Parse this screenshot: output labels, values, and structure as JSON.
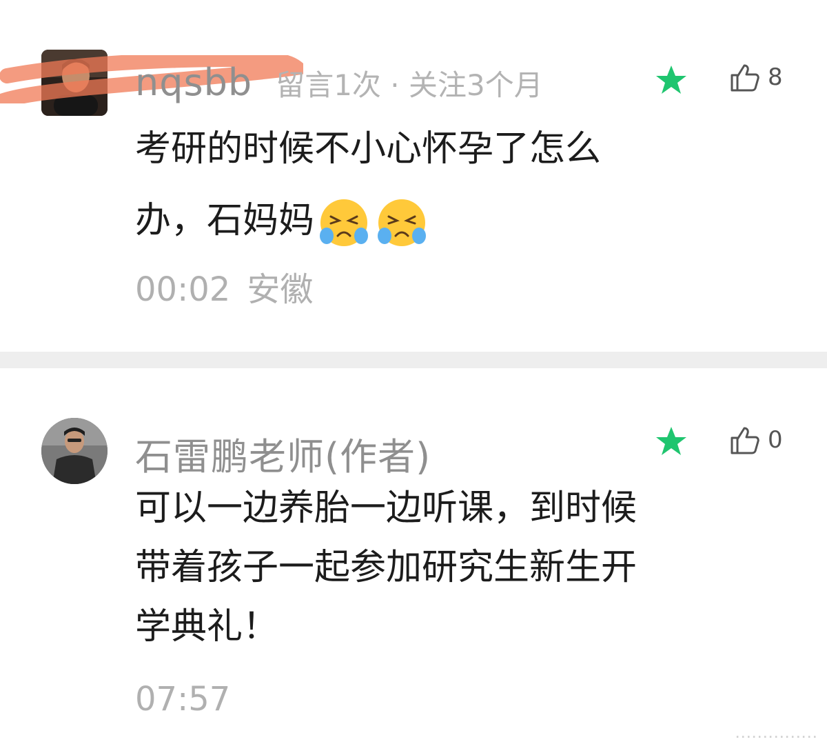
{
  "comments": [
    {
      "username": "nqsbb",
      "meta": "留言1次 · 关注3个月",
      "likes": "8",
      "text_line1": "考研的时候不小心怀孕了怎么",
      "text_line2": "办，石妈妈",
      "emoji": [
        "loudly-crying-face",
        "loudly-crying-face"
      ],
      "time": "00:02",
      "location": "安徽",
      "starred": true,
      "star_color": "#1fc56f"
    },
    {
      "username": "石雷鹏老师(作者)",
      "likes": "0",
      "text_line1": "可以一边养胎一边听课，到时候",
      "text_line2": "带着孩子一起参加研究生新生开",
      "text_line3": "学典礼！",
      "time": "07:57",
      "starred": true,
      "star_color": "#1fc56f"
    }
  ],
  "colors": {
    "highlight": "#f07a55",
    "divider": "#eeeeee",
    "muted_text": "#b0b0b0"
  },
  "watermark": "⋯⋯⋯⋯⋯"
}
